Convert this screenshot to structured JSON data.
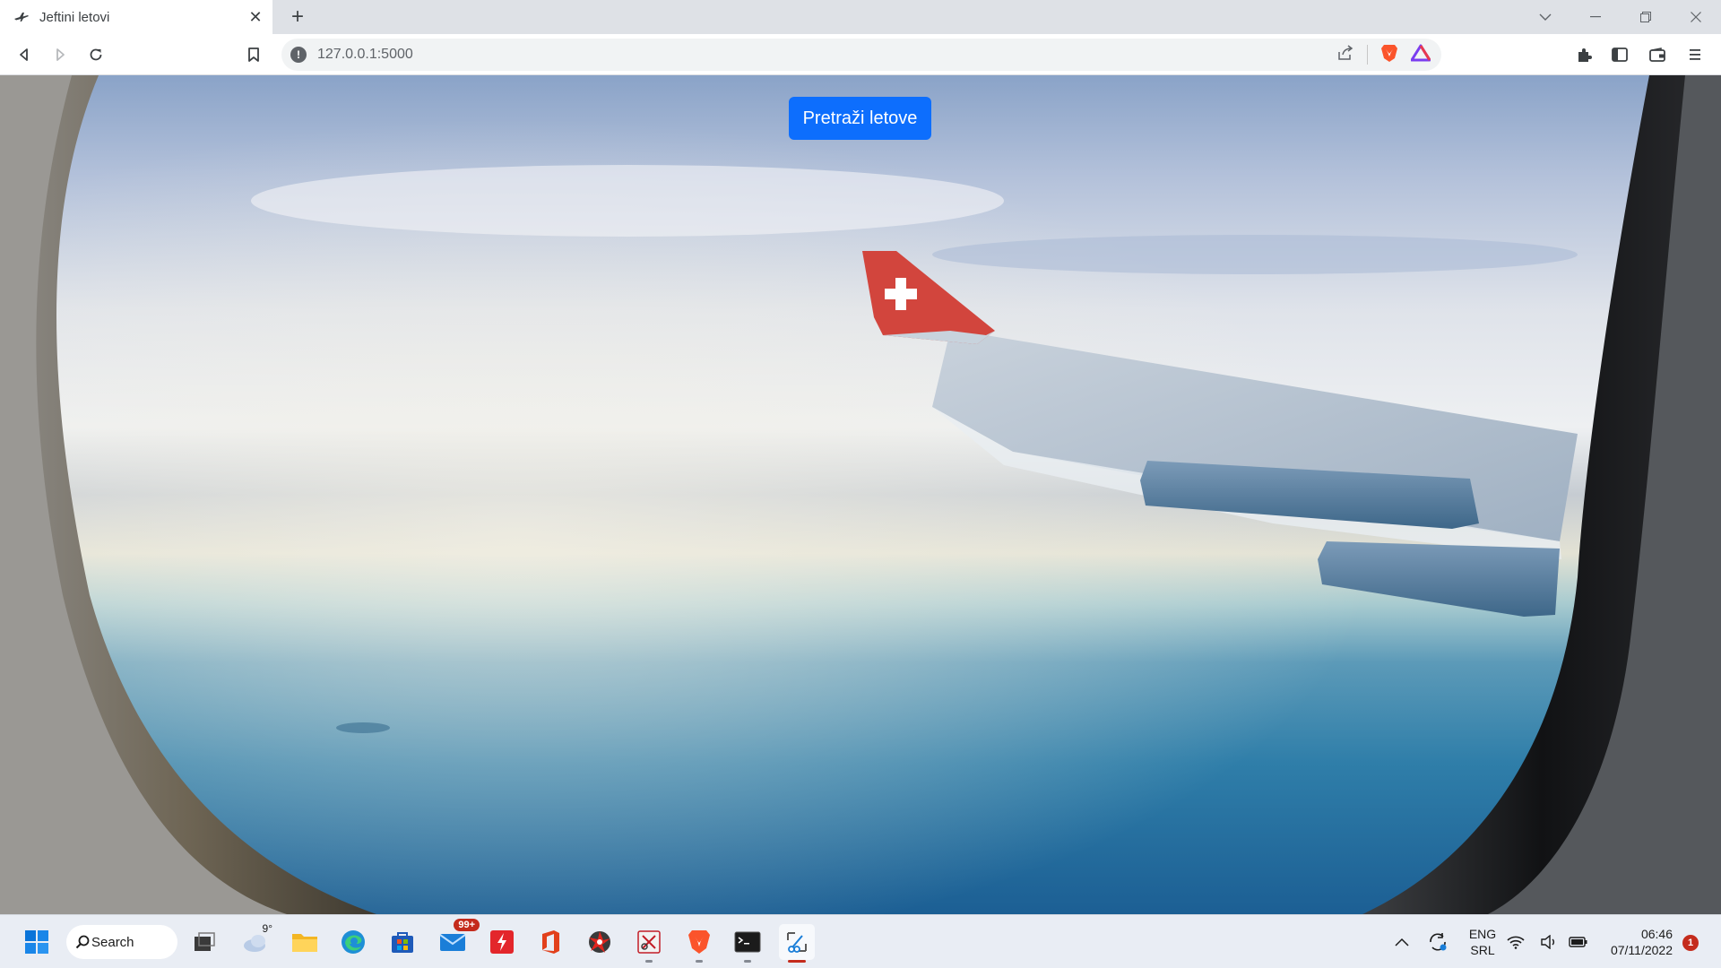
{
  "browser": {
    "tab": {
      "title": "Jeftini letovi",
      "favicon": "plane-icon"
    },
    "new_tab_label": "+",
    "address": {
      "url": "127.0.0.1:5000"
    }
  },
  "page": {
    "search_button_label": "Pretraži letove",
    "background": "airplane-window-wing-view",
    "accent_color": "#0d6efd"
  },
  "taskbar": {
    "search_label": "Search",
    "weather_temp": "9°",
    "mail_badge": "99+",
    "language": {
      "line1": "ENG",
      "line2": "SRL"
    },
    "clock": {
      "time": "06:46",
      "date": "07/11/2022"
    },
    "notification_count": "1"
  }
}
